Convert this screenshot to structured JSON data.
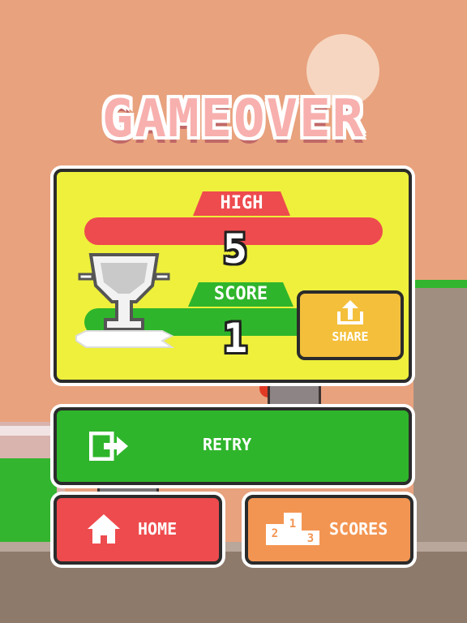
{
  "title": "GAMEOVER",
  "panel": {
    "high_label": "HIGH",
    "high_value": "5",
    "score_label": "SCORE",
    "score_value": "1",
    "share_label": "SHARE"
  },
  "buttons": {
    "retry": "RETRY",
    "home": "HOME",
    "scores": "SCORES"
  },
  "icons": {
    "trophy": "trophy-icon",
    "share": "share-icon",
    "retry": "retry-icon",
    "home": "home-icon",
    "podium": "podium-icon"
  },
  "colors": {
    "panel": "#eef03c",
    "high": "#ee4b4e",
    "score": "#2fb52b",
    "share": "#f4bf3b",
    "scores": "#f39552"
  }
}
